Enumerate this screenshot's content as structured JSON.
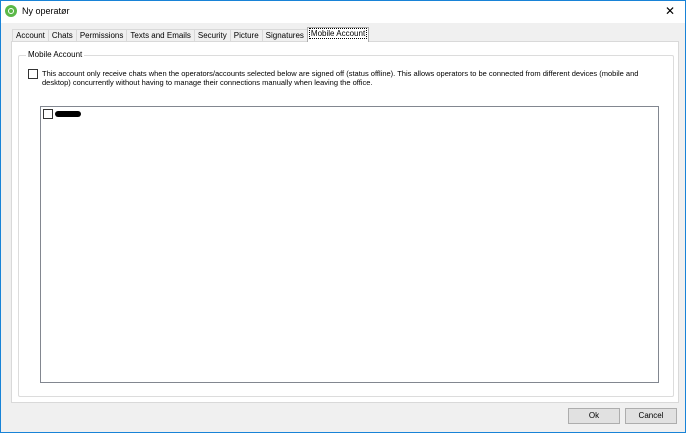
{
  "window": {
    "title": "Ny operatør"
  },
  "tabs": [
    {
      "label": "Account"
    },
    {
      "label": "Chats"
    },
    {
      "label": "Permissions"
    },
    {
      "label": "Texts and Emails"
    },
    {
      "label": "Security"
    },
    {
      "label": "Picture"
    },
    {
      "label": "Signatures"
    },
    {
      "label": "Mobile Account",
      "active": true
    }
  ],
  "mobile_account": {
    "group_label": "Mobile Account",
    "option_text": "This account only receive chats when the operators/accounts selected below are signed off (status offline). This allows operators to be connected from different devices (mobile and desktop) concurrently without having to manage their connections manually when leaving the office.",
    "option_checked": false,
    "operators": [
      {
        "name_redacted": true,
        "checked": false
      }
    ]
  },
  "buttons": {
    "ok": "Ok",
    "cancel": "Cancel"
  },
  "colors": {
    "window_border": "#1883d7",
    "app_icon": "#5bb848"
  }
}
